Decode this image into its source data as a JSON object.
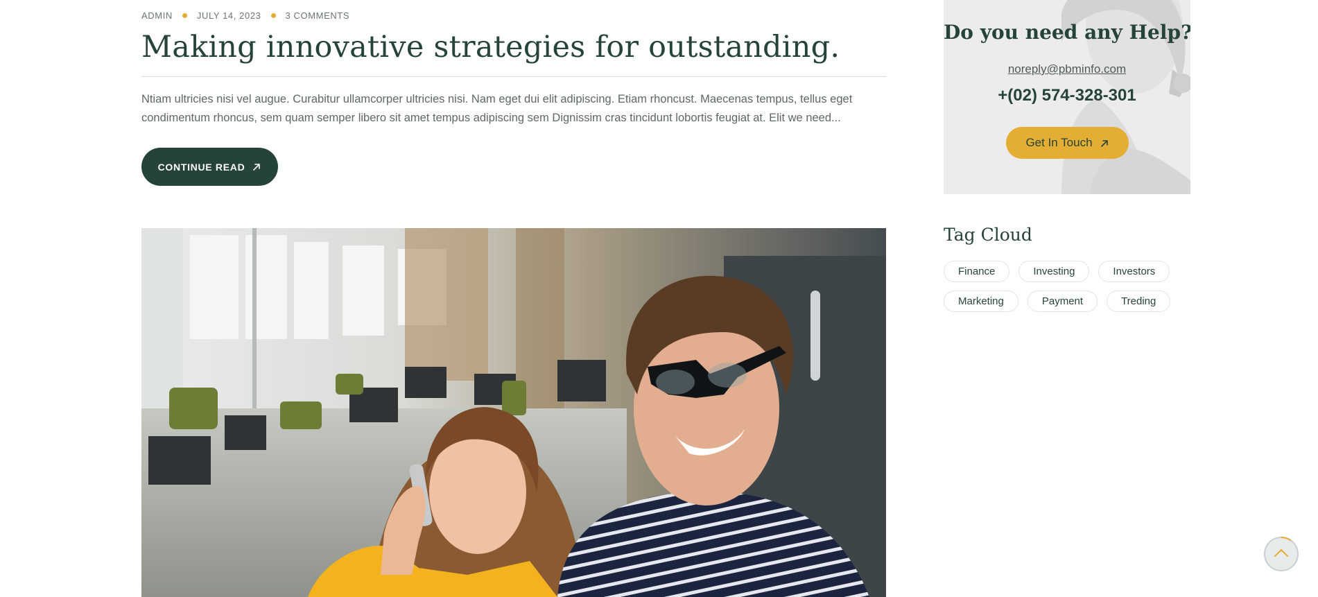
{
  "post": {
    "meta": {
      "author": "ADMIN",
      "date": "JULY 14, 2023",
      "comments": "3 COMMENTS"
    },
    "title": "Making innovative strategies for outstanding.",
    "excerpt": "Ntiam ultricies nisi vel augue. Curabitur ullamcorper ultricies nisi. Nam eget dui elit adipiscing. Etiam rhoncust. Maecenas tempus, tellus eget condimentum rhoncus, sem quam semper libero sit amet tempus adipiscing sem Dignissim cras tincidunt lobortis feugiat at. Elit we need...",
    "continue_label": "CONTINUE READ",
    "continue_icon": "arrow-up-right-icon"
  },
  "photo": {
    "icon": "office-photo"
  },
  "sidebar": {
    "help": {
      "title": "Do you need any Help?",
      "email": "noreply@pbminfo.com",
      "phone": "+(02) 574-328-301",
      "button_label": "Get In Touch",
      "button_icon": "arrow-up-right-icon"
    },
    "tag_cloud": {
      "heading": "Tag Cloud",
      "tags": [
        "Finance",
        "Investing",
        "Investors",
        "Marketing",
        "Payment",
        "Treding"
      ]
    }
  },
  "back_to_top": {
    "icon": "chevron-up-icon"
  },
  "colors": {
    "primary_dark": "#26433a",
    "accent_gold": "#e3ae33",
    "text_body": "#5e6863",
    "background": "#ffffff"
  }
}
